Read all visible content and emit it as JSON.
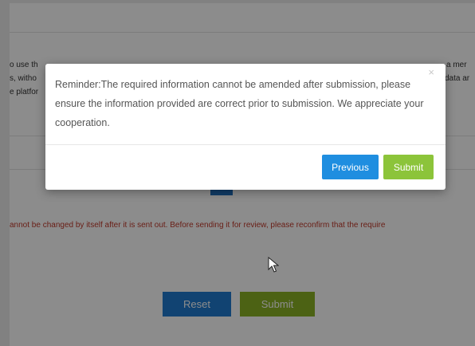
{
  "background": {
    "text_lines": [
      "o use th",
      "s, witho",
      "e platfor"
    ],
    "right_text_lines": [
      "a mer",
      "data ar"
    ],
    "warning_text": "annot be changed by itself after it is sent out. Before sending it for review, please reconfirm that the require",
    "reset_label": "Reset",
    "submit_label": "Submit"
  },
  "modal": {
    "close_glyph": "×",
    "message": "Reminder:The required information cannot be amended after submission, please ensure the information provided are correct prior to submission. We appreciate your cooperation.",
    "previous_label": "Previous",
    "submit_label": "Submit"
  },
  "colors": {
    "previous_button": "#1f8ee0",
    "submit_button": "#8cc43a",
    "warning_text": "#c0392b"
  },
  "icons": {
    "cursor": "mouse-pointer-icon",
    "close": "close-icon"
  }
}
